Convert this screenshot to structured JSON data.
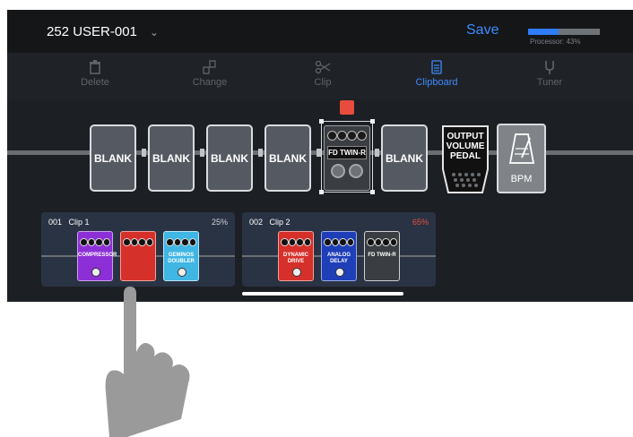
{
  "header": {
    "preset_name": "252 USER-001",
    "save_label": "Save",
    "processor_label": "Processor: 43%",
    "processor_value": 0.43
  },
  "toolbar": {
    "delete_label": "Delete",
    "change_label": "Change",
    "clip_label": "Clip",
    "clipboard_label": "Clipboard",
    "tuner_label": "Tuner"
  },
  "chain": {
    "blank_label": "BLANK",
    "amp_label": "FD TWIN-R",
    "output_volume_label": "OUTPUT VOLUME PEDAL",
    "bpm_label": "BPM"
  },
  "clips": [
    {
      "number": "001",
      "name": "Clip 1",
      "percent": "25%",
      "percent_color": "#cfd3d8",
      "pedals": [
        "COMPRESSOR",
        "",
        "GEMINOS DOUBLER"
      ]
    },
    {
      "number": "002",
      "name": "Clip 2",
      "percent": "65%",
      "percent_color": "#e74c3c",
      "pedals": [
        "DYNAMIC DRIVE",
        "ANALOG DELAY",
        "FD TWIN-R"
      ]
    }
  ],
  "colors": {
    "accent": "#3d8bff",
    "marker": "#e74c3c"
  }
}
